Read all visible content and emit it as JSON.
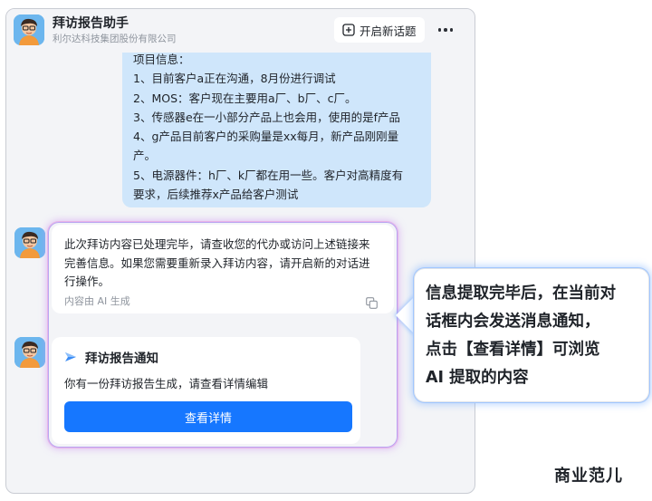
{
  "header": {
    "title": "拜访报告助手",
    "subtitle": "利尔达科技集团股份有限公司",
    "new_topic_label": "开启新话题"
  },
  "project_info": {
    "lines": [
      "项目信息：",
      "1、目前客户a正在沟通，8月份进行调试",
      "2、MOS：客户现在主要用a厂、b厂、c厂。",
      "3、传感器e在一小部分产品上也会用，使用的是f产品",
      "4、g产品目前客户的采购量是xx每月，新产品刚刚量",
      "产。",
      "5、电源器件：h厂、k厂都在用一些。客户对高精度有",
      "要求，后续推荐x产品给客户测试"
    ]
  },
  "ai_message": {
    "lines": [
      "此次拜访内容已处理完毕，请查收您的代办或访问上述链接来",
      "完善信息。如果您需要重新录入拜访内容，请开启新的对话进",
      "行操作。"
    ],
    "footer": "内容由 AI 生成"
  },
  "notice_card": {
    "title": "拜访报告通知",
    "body": "你有一份拜访报告生成，请查看详情编辑",
    "button_label": "查看详情"
  },
  "callout": {
    "lines": [
      "信息提取完毕后，在当前对",
      "话框内会发送消息通知，",
      "点击【查看详情】可浏览",
      "AI 提取的内容"
    ]
  },
  "watermark": "商业范儿",
  "colors": {
    "accent": "#1677ff",
    "bubble": "#cfe6fb",
    "panel_bg": "#f3f4f7"
  }
}
